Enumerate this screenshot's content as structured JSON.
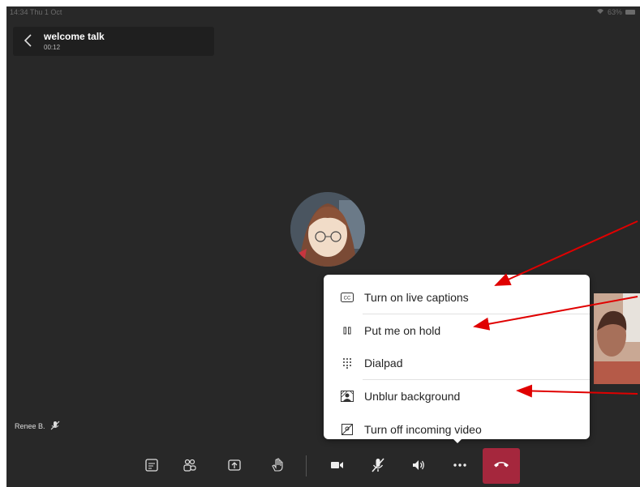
{
  "status_bar": {
    "time": "14:34 Thu 1 Oct",
    "battery": "63%"
  },
  "call": {
    "title": "welcome talk",
    "duration": "00:12"
  },
  "participant": {
    "name": "Renee B."
  },
  "menu": {
    "items": [
      {
        "label": "Turn on live captions",
        "icon": "closed-captions-icon"
      },
      {
        "label": "Put me on hold",
        "icon": "hold-icon"
      },
      {
        "label": "Dialpad",
        "icon": "dialpad-icon"
      },
      {
        "label": "Unblur background",
        "icon": "blur-background-icon"
      },
      {
        "label": "Turn off incoming video",
        "icon": "video-off-icon"
      }
    ]
  },
  "toolbar": {
    "buttons": [
      "chat-icon",
      "participants-icon",
      "share-icon",
      "raise-hand-icon",
      "camera-icon",
      "mic-muted-icon",
      "speaker-icon",
      "more-options-icon",
      "hang-up-icon"
    ]
  },
  "colors": {
    "background": "#282828",
    "hangup": "#a5273d",
    "annotation_arrow": "#e00000"
  }
}
